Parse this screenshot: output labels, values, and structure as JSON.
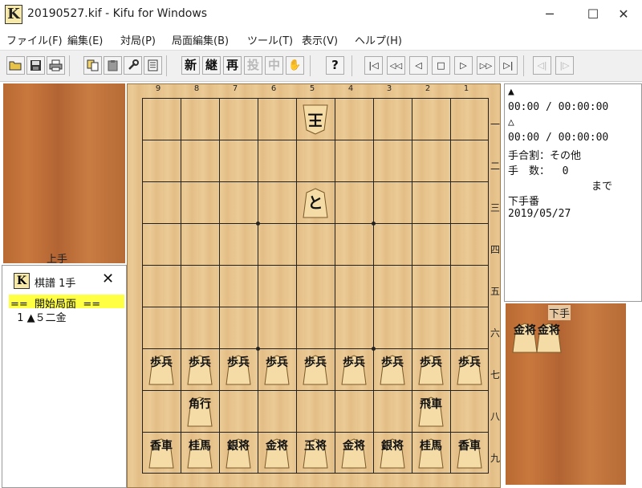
{
  "window": {
    "title": "20190527.kif - Kifu for Windows",
    "icon_letter": "K",
    "controls": {
      "minimize": "─",
      "maximize": "☐",
      "close": "✕"
    }
  },
  "menu": [
    "ファイル(F)",
    "編集(E)",
    "対局(P)",
    "局面編集(B)",
    "ツール(T)",
    "表示(V)",
    "ヘルプ(H)"
  ],
  "toolbar": {
    "icons": [
      "open-icon",
      "save-icon",
      "print-icon",
      "copy-icon",
      "paste-icon",
      "settings-icon",
      "list-icon"
    ],
    "text_buttons": [
      "新",
      "継",
      "再",
      "投",
      "中",
      "✋",
      "?"
    ],
    "nav_buttons": [
      "|◁",
      "◁◁",
      "◁",
      "□",
      "▷",
      "▷▷",
      "▷|",
      "◁|",
      "|▷"
    ]
  },
  "board": {
    "files": [
      "9",
      "8",
      "7",
      "6",
      "5",
      "4",
      "3",
      "2",
      "1"
    ],
    "ranks": [
      "一",
      "二",
      "三",
      "四",
      "五",
      "六",
      "七",
      "八",
      "九"
    ],
    "pieces": [
      {
        "label": "王",
        "row": 0,
        "col": 4,
        "side": "gote",
        "size": "single"
      },
      {
        "label": "と",
        "row": 2,
        "col": 4,
        "side": "sente",
        "size": "single"
      },
      {
        "label": "歩兵",
        "row": 6,
        "col": 0,
        "side": "sente",
        "size": "double"
      },
      {
        "label": "歩兵",
        "row": 6,
        "col": 1,
        "side": "sente",
        "size": "double"
      },
      {
        "label": "歩兵",
        "row": 6,
        "col": 2,
        "side": "sente",
        "size": "double"
      },
      {
        "label": "歩兵",
        "row": 6,
        "col": 3,
        "side": "sente",
        "size": "double"
      },
      {
        "label": "歩兵",
        "row": 6,
        "col": 4,
        "side": "sente",
        "size": "double"
      },
      {
        "label": "歩兵",
        "row": 6,
        "col": 5,
        "side": "sente",
        "size": "double"
      },
      {
        "label": "歩兵",
        "row": 6,
        "col": 6,
        "side": "sente",
        "size": "double"
      },
      {
        "label": "歩兵",
        "row": 6,
        "col": 7,
        "side": "sente",
        "size": "double"
      },
      {
        "label": "歩兵",
        "row": 6,
        "col": 8,
        "side": "sente",
        "size": "double"
      },
      {
        "label": "角行",
        "row": 7,
        "col": 1,
        "side": "sente",
        "size": "double"
      },
      {
        "label": "飛車",
        "row": 7,
        "col": 7,
        "side": "sente",
        "size": "double"
      },
      {
        "label": "香車",
        "row": 8,
        "col": 0,
        "side": "sente",
        "size": "double"
      },
      {
        "label": "桂馬",
        "row": 8,
        "col": 1,
        "side": "sente",
        "size": "double"
      },
      {
        "label": "銀将",
        "row": 8,
        "col": 2,
        "side": "sente",
        "size": "double"
      },
      {
        "label": "金将",
        "row": 8,
        "col": 3,
        "side": "sente",
        "size": "double"
      },
      {
        "label": "玉将",
        "row": 8,
        "col": 4,
        "side": "sente",
        "size": "double"
      },
      {
        "label": "金将",
        "row": 8,
        "col": 5,
        "side": "sente",
        "size": "double"
      },
      {
        "label": "銀将",
        "row": 8,
        "col": 6,
        "side": "sente",
        "size": "double"
      },
      {
        "label": "桂馬",
        "row": 8,
        "col": 7,
        "side": "sente",
        "size": "double"
      },
      {
        "label": "香車",
        "row": 8,
        "col": 8,
        "side": "sente",
        "size": "double"
      }
    ]
  },
  "gote_hand": {
    "label": "上手"
  },
  "sente_hand": {
    "label": "下手",
    "pieces": [
      "金将",
      "金将"
    ]
  },
  "info": {
    "sente_mark": "▲",
    "sente_time": "00:00 / 00:00:00",
    "gote_mark": "△",
    "gote_time": "00:00 / 00:00:00",
    "handicap": "手合割：その他",
    "move_count": "手　数：  0",
    "made": "まで",
    "turn": "下手番",
    "date": "2019/05/27"
  },
  "kifu": {
    "title": "棋譜 1手",
    "close": "✕",
    "rows": [
      "==  開始局面  ==",
      "  1 ▲５二金"
    ]
  }
}
